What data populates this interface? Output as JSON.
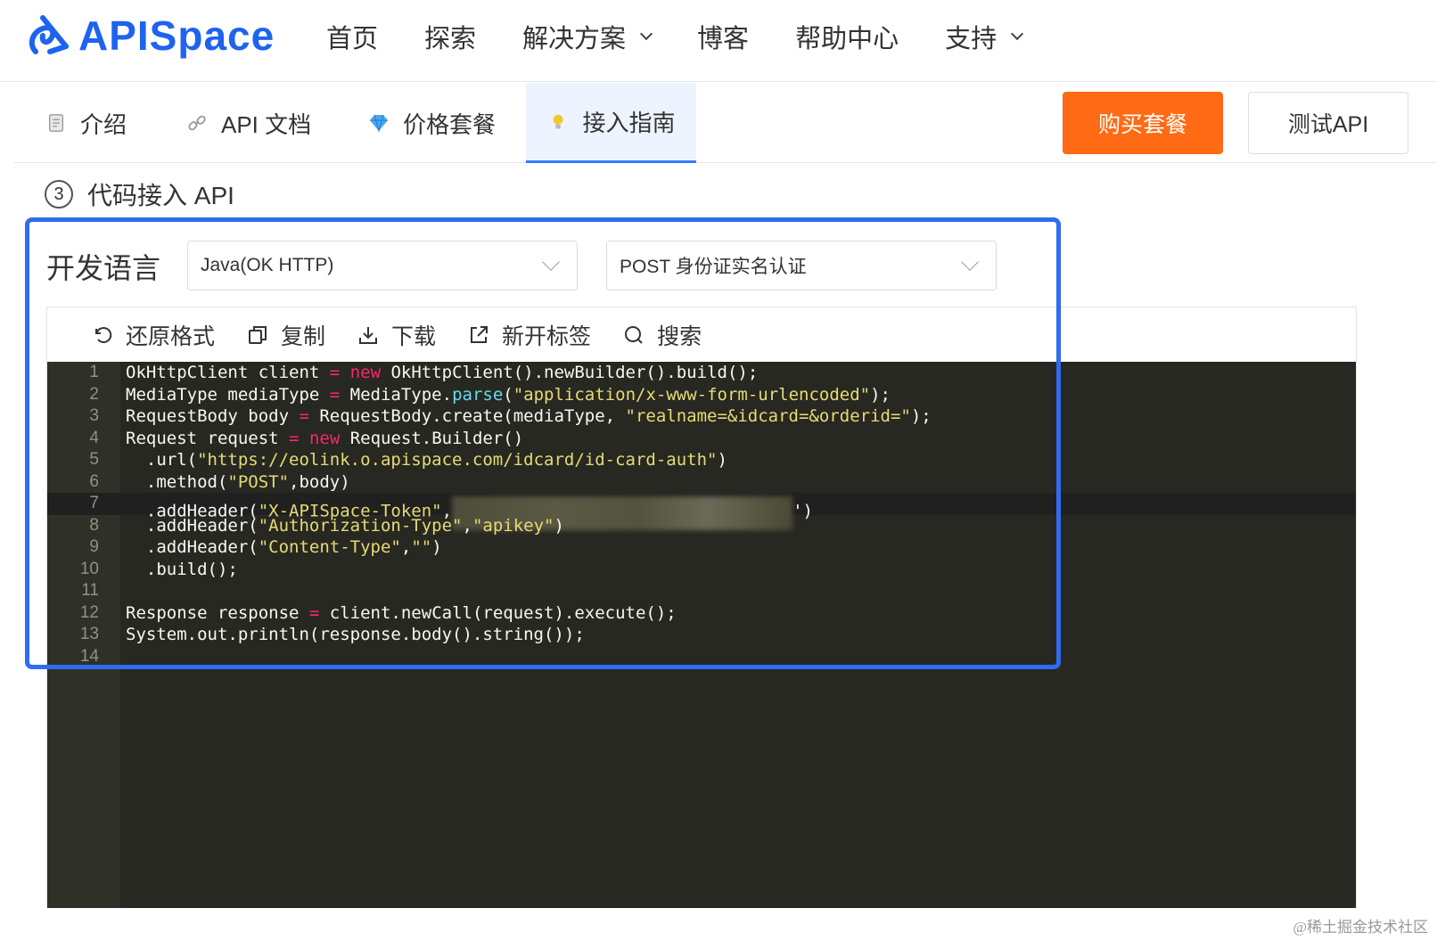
{
  "nav": {
    "logo_text": "APISpace",
    "items": [
      {
        "label": "首页",
        "dropdown": false
      },
      {
        "label": "探索",
        "dropdown": false
      },
      {
        "label": "解决方案",
        "dropdown": true
      },
      {
        "label": "博客",
        "dropdown": false
      },
      {
        "label": "帮助中心",
        "dropdown": false
      },
      {
        "label": "支持",
        "dropdown": true
      }
    ]
  },
  "tabs": [
    {
      "label": "介绍",
      "icon": "document-icon"
    },
    {
      "label": "API 文档",
      "icon": "link-icon"
    },
    {
      "label": "价格套餐",
      "icon": "diamond-icon"
    },
    {
      "label": "接入指南",
      "icon": "lightbulb-icon",
      "active": true
    }
  ],
  "actions": {
    "buy": "购买套餐",
    "test": "测试API"
  },
  "step": {
    "number": "3",
    "title": "代码接入 API"
  },
  "language": {
    "label": "开发语言",
    "selected_lang": "Java(OK HTTP)",
    "selected_api": "POST 身份证实名认证"
  },
  "toolbar": [
    {
      "label": "还原格式",
      "icon": "undo-icon"
    },
    {
      "label": "复制",
      "icon": "copy-icon"
    },
    {
      "label": "下载",
      "icon": "download-icon"
    },
    {
      "label": "新开标签",
      "icon": "external-link-icon"
    },
    {
      "label": "搜索",
      "icon": "search-icon"
    }
  ],
  "code_lines": [
    "OkHttpClient client = new OkHttpClient().newBuilder().build();",
    "MediaType mediaType = MediaType.parse(\"application/x-www-form-urlencoded\");",
    "RequestBody body = RequestBody.create(mediaType, \"realname=&idcard=&orderid=\");",
    "Request request = new Request.Builder()",
    "  .url(\"https://eolink.o.apispace.com/idcard/id-card-auth\")",
    "  .method(\"POST\",body)",
    "  .addHeader(\"X-APISpace-Token\",\"\")",
    "  .addHeader(\"Authorization-Type\",\"apikey\")",
    "  .addHeader(\"Content-Type\",\"\")",
    "  .build();",
    "",
    "Response response = client.newCall(request).execute();",
    "System.out.println(response.body().string());",
    ""
  ],
  "highlighted_line": 7,
  "watermark": "@稀土掘金技术社区",
  "colors": {
    "brand": "#1e63f0",
    "buy_button": "#ff6a14",
    "outline": "#2f6cf0",
    "editor_bg": "#272822"
  }
}
